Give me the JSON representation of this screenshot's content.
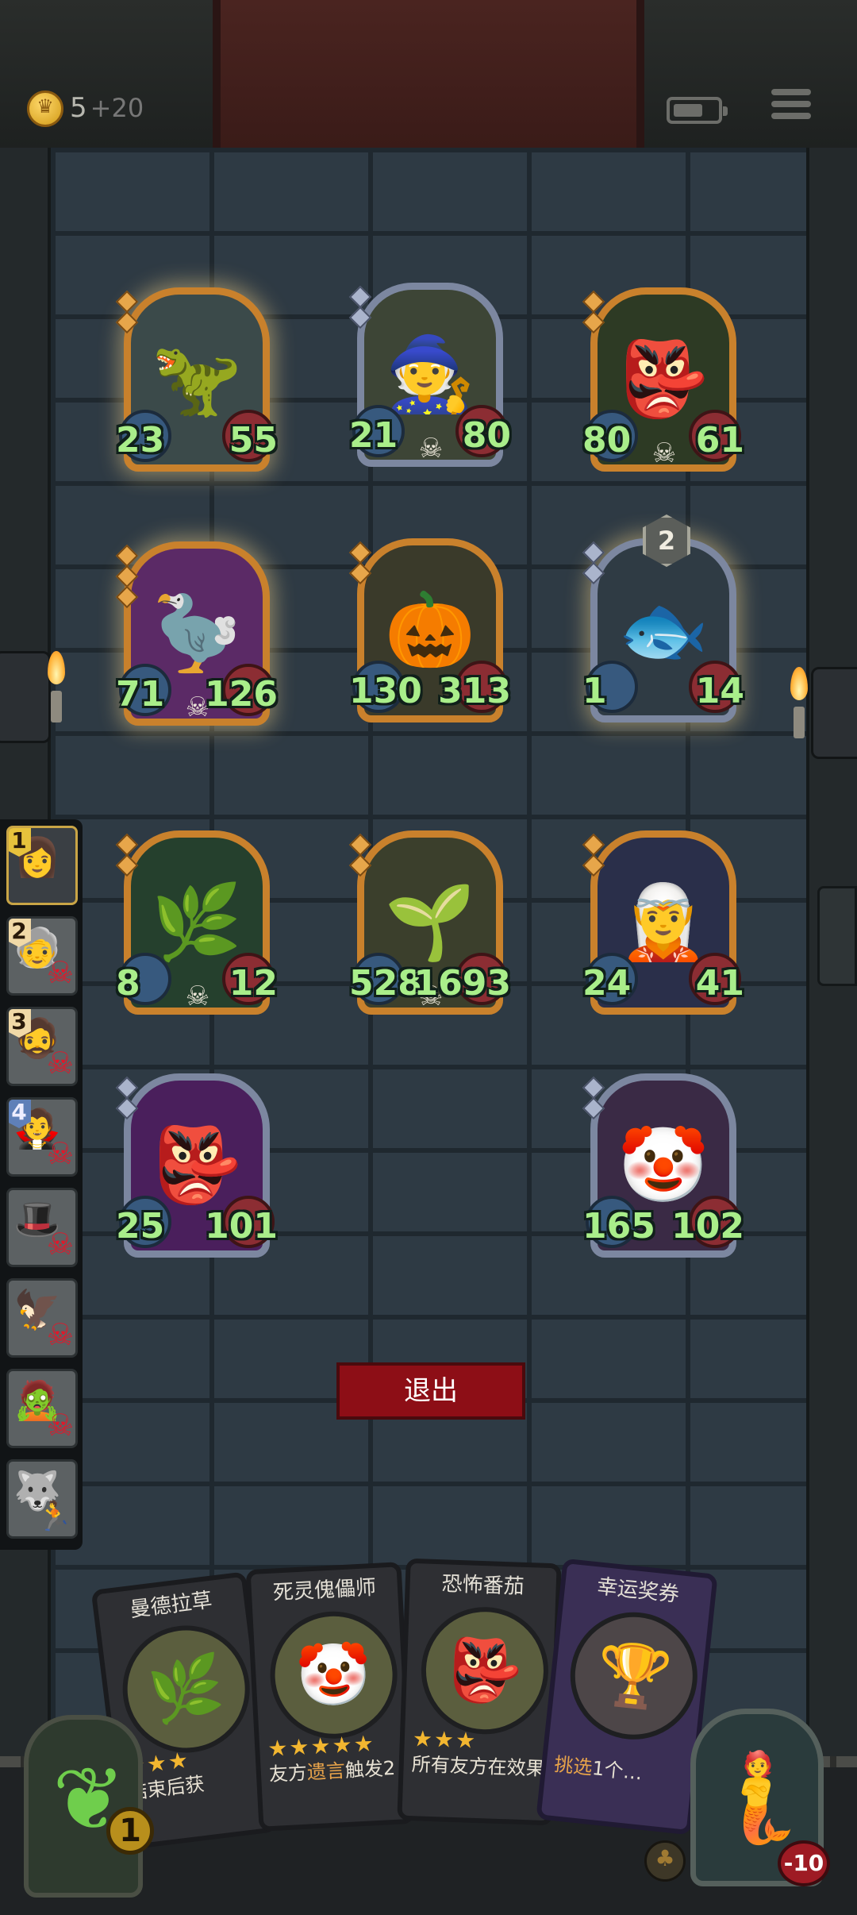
{
  "header": {
    "gold": "5",
    "gold_income": "+20"
  },
  "board": {
    "minions": [
      {
        "atk": "23",
        "hp": "55",
        "art": "🦖",
        "frame": "gold",
        "bg": "#3b4a4a",
        "glow": true,
        "skull": false,
        "tiers": 2
      },
      {
        "atk": "21",
        "hp": "80",
        "art": "🧙",
        "frame": "silver",
        "bg": "#3d4536",
        "glow": false,
        "skull": true,
        "tiers": 2
      },
      {
        "atk": "80",
        "hp": "61",
        "art": "👺",
        "frame": "gold",
        "bg": "#2d3a24",
        "glow": false,
        "skull": true,
        "tiers": 2
      },
      {
        "atk": "71",
        "hp": "126",
        "art": "🦤",
        "frame": "gold",
        "bg": "#5b2a66",
        "glow": true,
        "skull": true,
        "tiers": 3
      },
      {
        "atk": "130",
        "hp": "313",
        "art": "🎃",
        "frame": "gold",
        "bg": "#3a3a2a",
        "glow": false,
        "skull": false,
        "tiers": 2
      },
      {
        "atk": "1",
        "hp": "14",
        "art": "🐟",
        "frame": "silver",
        "bg": "#2f3b44",
        "glow": true,
        "skull": false,
        "tiers": 2,
        "level": "2"
      },
      {
        "atk": "8",
        "hp": "12",
        "art": "🌿",
        "frame": "gold",
        "bg": "#25402d",
        "glow": false,
        "skull": true,
        "tiers": 2
      },
      {
        "atk": "528",
        "hp": "1693",
        "art": "🌱",
        "frame": "gold",
        "bg": "#3b3f2c",
        "glow": false,
        "skull": true,
        "tiers": 2
      },
      {
        "atk": "24",
        "hp": "41",
        "art": "🧝",
        "frame": "gold",
        "bg": "#2a2f4a",
        "glow": false,
        "skull": false,
        "tiers": 2
      },
      {
        "atk": "25",
        "hp": "101",
        "art": "👺",
        "frame": "silver",
        "bg": "#4a1f5c",
        "glow": false,
        "skull": false,
        "tiers": 2
      },
      {
        "atk": "165",
        "hp": "102",
        "art": "🤡",
        "frame": "silver",
        "bg": "#3a2a45",
        "glow": false,
        "skull": false,
        "tiers": 2
      }
    ]
  },
  "turn_order": [
    {
      "num": "1",
      "face": "👩",
      "status": "alive",
      "badge": "gold"
    },
    {
      "num": "2",
      "face": "🧓",
      "status": "dead",
      "badge": "cream"
    },
    {
      "num": "3",
      "face": "🧔",
      "status": "dead",
      "badge": "cream"
    },
    {
      "num": "4",
      "face": "🧛",
      "status": "dead",
      "badge": "blue"
    },
    {
      "num": "",
      "face": "🎩",
      "status": "dead",
      "badge": ""
    },
    {
      "num": "",
      "face": "🦅",
      "status": "dead",
      "badge": ""
    },
    {
      "num": "",
      "face": "🧟",
      "status": "dead",
      "badge": ""
    },
    {
      "num": "",
      "face": "🐺",
      "status": "fled",
      "badge": ""
    }
  ],
  "exit_label": "退出",
  "shop": {
    "cards": [
      {
        "title": "曼德拉草",
        "art": "🌿",
        "stars": "★★★",
        "desc1": "结束后",
        "desc1_hl": "",
        "desc2": "获",
        "type": "normal"
      },
      {
        "title": "死灵傀儡师",
        "art": "🤡",
        "stars": "★★★★★",
        "desc1": "友方",
        "desc1_hl": "遗言",
        "desc2": "触发2",
        "type": "normal"
      },
      {
        "title": "恐怖番茄",
        "art": "👺",
        "stars": "★★★",
        "desc1": "所有友方在",
        "desc1_hl": "",
        "desc2": "效果时都会",
        "type": "normal"
      },
      {
        "title": "幸运奖券",
        "art": "🏆",
        "stars": "",
        "desc1": "",
        "desc1_hl": "挑选",
        "desc2": "1个…",
        "type": "voucher"
      }
    ]
  },
  "deck_count": "1",
  "hero_health": "-10"
}
